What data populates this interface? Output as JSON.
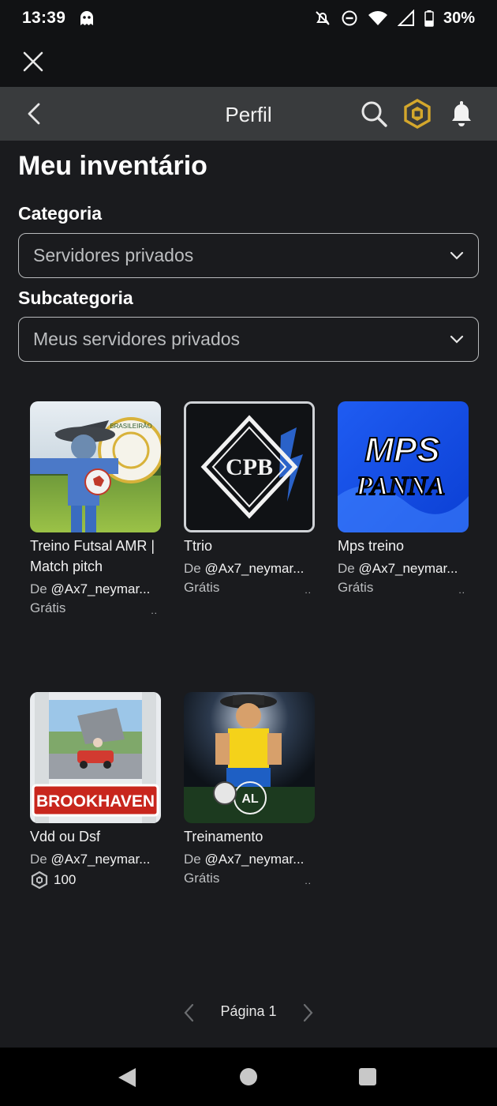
{
  "status": {
    "time": "13:39",
    "battery": "30%"
  },
  "header": {
    "title": "Perfil"
  },
  "page": {
    "title": "Meu inventário"
  },
  "category": {
    "label": "Categoria",
    "value": "Servidores privados"
  },
  "subcategory": {
    "label": "Subcategoria",
    "value": "Meus servidores privados"
  },
  "items": [
    {
      "title": "Treino Futsal AMR | Match pitch",
      "creator_prefix": "De",
      "creator": "@Ax7_neymar...",
      "price": "Grátis",
      "more": ".."
    },
    {
      "title": "Ttrio",
      "creator_prefix": "De",
      "creator": "@Ax7_neymar...",
      "price": "Grátis",
      "more": ".."
    },
    {
      "title": "Mps treino",
      "creator_prefix": "De",
      "creator": "@Ax7_neymar...",
      "price": "Grátis",
      "more": ".."
    },
    {
      "title": "Vdd ou Dsf",
      "creator_prefix": "De",
      "creator": "@Ax7_neymar...",
      "price": "100",
      "price_icon": "robux-icon"
    },
    {
      "title": "Treinamento",
      "creator_prefix": "De",
      "creator": "@Ax7_neymar...",
      "price": "Grátis",
      "more": ".."
    }
  ],
  "thumb_text": {
    "mps_line1": "MPS",
    "mps_line2": "PANNA",
    "cpb": "CPB",
    "brookhaven": "BROOKHAVEN",
    "brasileirao": "BRASILEIRÃO",
    "al_badge": "AL"
  },
  "pagination": {
    "label": "Página 1"
  },
  "colors": {
    "background": "#1a1b1e",
    "header": "#393b3d",
    "robux_gold": "#d4a72c"
  }
}
